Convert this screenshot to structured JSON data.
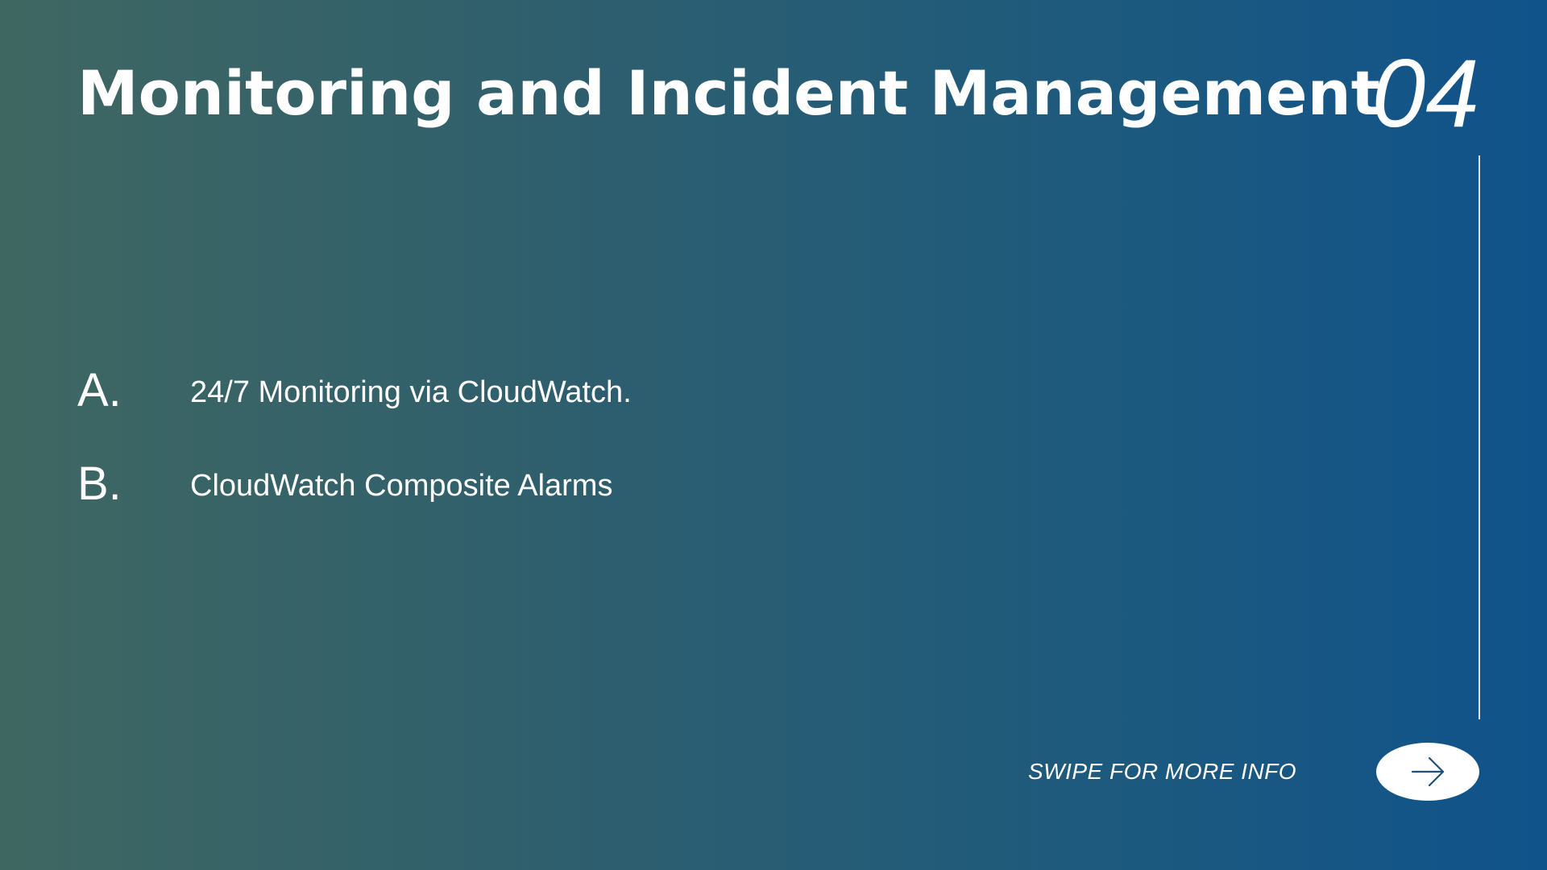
{
  "slide": {
    "title": "Monitoring and Incident Management",
    "number": "04",
    "items": [
      {
        "letter": "A.",
        "text": "24/7 Monitoring via CloudWatch."
      },
      {
        "letter": "B.",
        "text": "CloudWatch Composite Alarms"
      }
    ],
    "footer": {
      "swipe_label": "SWIPE FOR MORE INFO",
      "next_icon": "arrow-right-icon"
    }
  },
  "colors": {
    "gradient_start": "#3f6762",
    "gradient_end": "#10538b",
    "text": "#ffffff",
    "arrow": "#1e4f7a"
  }
}
